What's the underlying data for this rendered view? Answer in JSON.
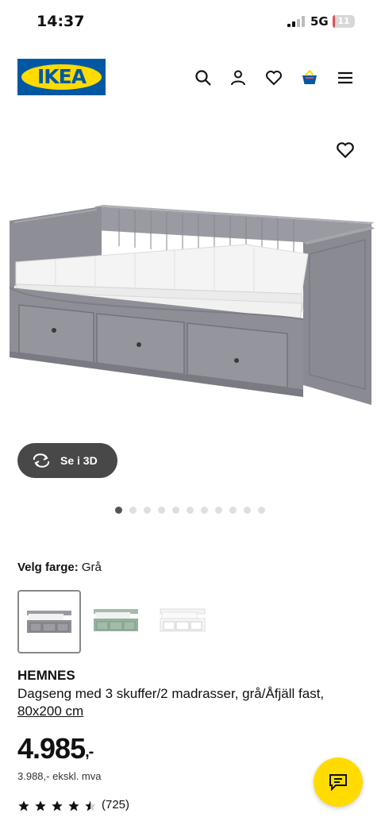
{
  "status_bar": {
    "time": "14:37",
    "network": "5G",
    "battery": "11",
    "battery_level": 0.11
  },
  "header": {
    "logo_text": "IKEA",
    "icons": [
      "search-icon",
      "account-icon",
      "heart-icon",
      "basket-icon",
      "menu-icon"
    ]
  },
  "gallery": {
    "view_3d_label": "Se i 3D",
    "image_count": 11,
    "active_index": 0
  },
  "color": {
    "label": "Velg farge:",
    "value": "Grå",
    "options": [
      "Grå",
      "Grønn",
      "Hvit"
    ],
    "selected": 0
  },
  "product": {
    "name": "HEMNES",
    "description": "Dagseng med 3 skuffer/2 madrasser, grå/Åfjäll fast,",
    "size_link": "80x200 cm",
    "price": "4.985",
    "price_suffix": ",-",
    "ex_vat": "3.988,- ekskl. mva",
    "rating": 4.5,
    "review_count": "(725)"
  },
  "colors": {
    "brand_blue": "#0058a3",
    "brand_yellow": "#ffdb00",
    "bed_gray": "#8e8f96"
  }
}
